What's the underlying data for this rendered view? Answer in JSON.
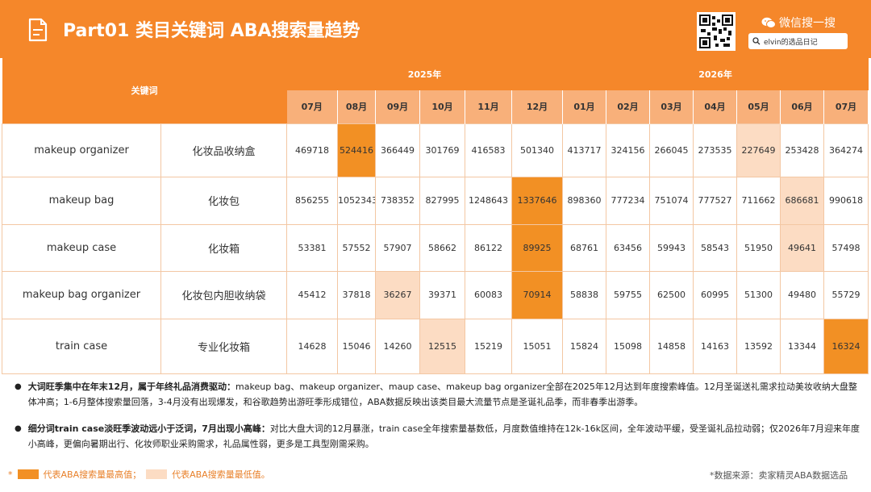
{
  "header": {
    "title": "Part01 类目关键词 ABA搜索量趋势",
    "wechat_label": "微信搜一搜",
    "search_text": "elvin的选品日记"
  },
  "table": {
    "keyword_header": "关键词",
    "years": [
      {
        "label": "2025年",
        "span": 6
      },
      {
        "label": "2026年",
        "span": 7
      }
    ],
    "months": [
      "07月",
      "08月",
      "09月",
      "10月",
      "11月",
      "12月",
      "01月",
      "02月",
      "03月",
      "04月",
      "05月",
      "06月",
      "07月"
    ],
    "rows": [
      {
        "en": "makeup organizer",
        "zh": "化妆品收纳盒",
        "values": [
          "469718",
          "524416",
          "366449",
          "301769",
          "416583",
          "501340",
          "413717",
          "324156",
          "266045",
          "273535",
          "227649",
          "253428",
          "364274"
        ],
        "high": 1,
        "low": 10
      },
      {
        "en": "makeup bag",
        "zh": "化妆包",
        "values": [
          "856255",
          "1052343",
          "738352",
          "827995",
          "1248643",
          "1337646",
          "898360",
          "777234",
          "751074",
          "777527",
          "711662",
          "686681",
          "990618"
        ],
        "high": 5,
        "low": 11
      },
      {
        "en": "makeup case",
        "zh": "化妆箱",
        "values": [
          "53381",
          "57552",
          "57907",
          "58662",
          "86122",
          "89925",
          "68761",
          "63456",
          "59943",
          "58543",
          "51950",
          "49641",
          "57498"
        ],
        "high": 5,
        "low": 11
      },
      {
        "en": "makeup bag organizer",
        "zh": "化妆包内胆收纳袋",
        "values": [
          "45412",
          "37818",
          "36267",
          "39371",
          "60083",
          "70914",
          "58838",
          "59755",
          "62500",
          "60995",
          "51300",
          "49480",
          "55729"
        ],
        "high": 5,
        "low": 2
      },
      {
        "en": "train case",
        "zh": "专业化妆箱",
        "values": [
          "14628",
          "15046",
          "14260",
          "12515",
          "15219",
          "15051",
          "15824",
          "15098",
          "14858",
          "14163",
          "13592",
          "13344",
          "16324"
        ],
        "high": 12,
        "low": 3
      }
    ]
  },
  "notes": [
    {
      "bold": "大词旺季集中在年末12月，属于年终礼品消费驱动：",
      "text": "makeup bag、makeup organizer、maup case、makeup bag organizer全部在2025年12月达到年度搜索峰值。12月圣诞送礼需求拉动美妆收纳大盘整体冲高；1-6月整体搜索量回落，3-4月没有出现爆发，和谷歌趋势出游旺季形成错位，ABA数据反映出该类目最大流量节点是圣诞礼品季，而非春季出游季。"
    },
    {
      "bold": "细分词train case淡旺季波动远小于泛词，7月出现小高峰：",
      "text": "对比大盘大词的12月暴涨，train case全年搜索量基数低，月度数值维持在12k-16k区间，全年波动平缓，受圣诞礼品拉动弱；仅2026年7月迎来年度小高峰，更偏向暑期出行、化妆师职业采购需求，礼品属性弱，更多是工具型刚需采购。"
    }
  ],
  "legend": {
    "prefix": "*",
    "high_label": "代表ABA搜索量最高值；",
    "low_label": "代表ABA搜索量最低值。"
  },
  "source": "*数据来源：卖家精灵ABA数据选品",
  "colors": {
    "brand": "#f5872a",
    "high": "#f29024",
    "low": "#fcdcc3"
  }
}
